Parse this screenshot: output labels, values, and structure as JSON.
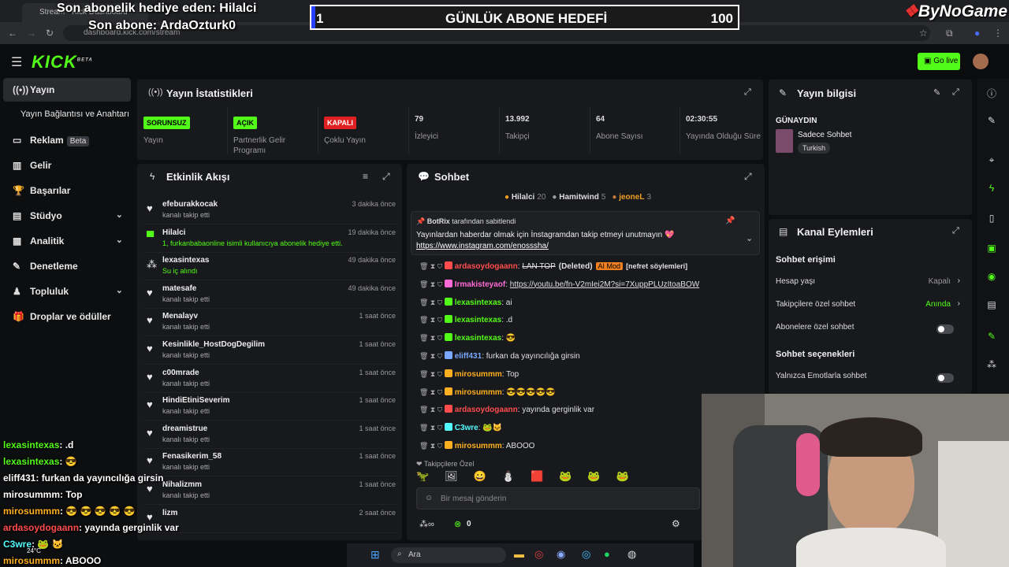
{
  "overlay": {
    "last_gift": "Son abonelik hediye eden: Hilalci",
    "last_sub": "Son abone: ArdaOzturk0",
    "goal": {
      "current": "1",
      "title": "GÜNLÜK ABONE HEDEFİ",
      "target": "100",
      "progress": 0.01
    },
    "brand": "ByNoGame"
  },
  "browser": {
    "tab_title": "Stream - Kick Dashboard",
    "url": "dashboard.kick.com/stream"
  },
  "header": {
    "logo": "KICK",
    "logo_beta": "BETA",
    "go_live": "Go live"
  },
  "sidebar": {
    "items": [
      {
        "label": "Yayın",
        "icon": "broadcast-icon"
      },
      {
        "label": "Yayın Bağlantısı ve Anahtarı"
      },
      {
        "label": "Reklam",
        "badge": "Beta",
        "icon": "ad-icon"
      },
      {
        "label": "Gelir",
        "icon": "chart-icon"
      },
      {
        "label": "Başarılar",
        "icon": "trophy-icon"
      },
      {
        "label": "Stüdyo",
        "icon": "studio-icon"
      },
      {
        "label": "Analitik",
        "icon": "analytics-icon"
      },
      {
        "label": "Denetleme",
        "icon": "wrench-icon"
      },
      {
        "label": "Topluluk",
        "icon": "community-icon"
      },
      {
        "label": "Droplar ve ödüller",
        "icon": "gift-icon"
      }
    ]
  },
  "stats": {
    "title": "Yayın İstatistikleri",
    "items": [
      {
        "value": "SORUNSUZ",
        "label": "Yayın",
        "color": "#53fc18"
      },
      {
        "value": "AÇIK",
        "label": "Partnerlik Gelir Programı",
        "color": "#53fc18"
      },
      {
        "value": "KAPALI",
        "label": "Çoklu Yayın",
        "color": "#e02020"
      },
      {
        "value": "79",
        "label": "İzleyici"
      },
      {
        "value": "13.992",
        "label": "Takipçi"
      },
      {
        "value": "64",
        "label": "Abone Sayısı"
      },
      {
        "value": "02:30:55",
        "label": "Yayında Olduğu Süre"
      }
    ]
  },
  "activity": {
    "title": "Etkinlik Akışı",
    "items": [
      {
        "name": "efeburakkocak",
        "sub": "kanalı takip etti",
        "time": "3 dakika önce"
      },
      {
        "name": "Hilalci",
        "sub": "1, furkanbabaonline isimli kullanıcıya abonelik hediye etti.",
        "time": "19 dakika önce"
      },
      {
        "name": "lexasintexas",
        "sub": "Su iç alındı",
        "time": "49 dakika önce"
      },
      {
        "name": "matesafe",
        "sub": "kanalı takip etti",
        "time": "49 dakika önce"
      },
      {
        "name": "Menalayv",
        "sub": "kanalı takip etti",
        "time": "1 saat önce"
      },
      {
        "name": "Kesinlikle_HostDogDegilim",
        "sub": "kanalı takip etti",
        "time": "1 saat önce"
      },
      {
        "name": "c00mrade",
        "sub": "kanalı takip etti",
        "time": "1 saat önce"
      },
      {
        "name": "HindiEtiniSeverim",
        "sub": "kanalı takip etti",
        "time": "1 saat önce"
      },
      {
        "name": "dreamistrue",
        "sub": "kanalı takip etti",
        "time": "1 saat önce"
      },
      {
        "name": "Fenasikerim_58",
        "sub": "kanalı takip etti",
        "time": "1 saat önce"
      },
      {
        "name": "Nihalizmm",
        "sub": "kanalı takip etti",
        "time": "1 saat önce"
      },
      {
        "name": "lizm",
        "sub": "",
        "time": "2 saat önce"
      }
    ]
  },
  "chat": {
    "title": "Sohbet",
    "top_gifters": [
      {
        "name": "Hilalci",
        "count": "20"
      },
      {
        "name": "Hamitwind",
        "count": "5"
      },
      {
        "name": "jeoneL",
        "count": "3"
      }
    ],
    "pinned": {
      "by": "BotRix",
      "by_suffix": "tarafından sabitlendi",
      "text": "Yayınlardan haberdar olmak için İnstagramdan takip etmeyi unutmayın 💖",
      "link": "https://www.instagram.com/enossshа/"
    },
    "messages": [
      {
        "user": "ardasoydogaann",
        "color": "#ff4d4d",
        "text": "LAN TOP",
        "extra": "(Deleted)",
        "tag": "AI Mod",
        "tag2": "[nefret söylemleri]"
      },
      {
        "user": "Irmakisteyaof",
        "color": "#ff6bd6",
        "text": "https://youtu.be/fn-V2mIei2M?si=7XuppPLUzItoaBOW"
      },
      {
        "user": "lexasintexas",
        "color": "#53fc18",
        "text": "ai"
      },
      {
        "user": "lexasintexas",
        "color": "#53fc18",
        "text": ".d"
      },
      {
        "user": "lexasintexas",
        "color": "#53fc18",
        "text": "😎"
      },
      {
        "user": "eliff431",
        "color": "#7aa7ff",
        "text": "furkan da yayıncılığa girsin"
      },
      {
        "user": "mirosummm",
        "color": "#ffb020",
        "text": "Top"
      },
      {
        "user": "mirosummm",
        "color": "#ffb020",
        "text": "😎😎😎😎😎"
      },
      {
        "user": "ardasoydogaann",
        "color": "#ff4d4d",
        "text": "yayında gerginlik var"
      },
      {
        "user": "C3wre",
        "color": "#53fcff",
        "text": "🐸🐱"
      },
      {
        "user": "mirosummm",
        "color": "#ffb020",
        "text": "ABOOO"
      }
    ],
    "follower_only_label": "Takipçilere Özel",
    "input_placeholder": "Bir mesaj gönderin",
    "footer_count": "0"
  },
  "stream_info": {
    "title": "Yayın bilgisi",
    "stream_title": "GÜNAYDIN",
    "category": "Sadece Sohbet",
    "language": "Turkish"
  },
  "channel_actions": {
    "title": "Kanal Eylemleri",
    "chat_access": "Sohbet erişimi",
    "account_age": "Hesap yaşı",
    "account_age_value": "Kapalı",
    "followers_only": "Takipçilere özel sohbet",
    "followers_only_value": "Anında",
    "subs_only": "Abonelere özel sohbet",
    "chat_options": "Sohbet seçenekleri",
    "emote_only": "Yalnızca Emotlarla sohbet"
  },
  "overlay_chat": [
    {
      "user": "lexasintexas",
      "text": ": .d",
      "color": "#53fc18"
    },
    {
      "user": "lexasintexas",
      "text": ": 😎",
      "color": "#53fc18"
    },
    {
      "user": "eliff431",
      "text": ": furkan da yayıncılığa girsin",
      "color": "#ffffff"
    },
    {
      "user": "mirosummm",
      "text": ": Top",
      "color": "#ffffff"
    },
    {
      "user": "mirosummm",
      "text": ": 😎 😎 😎 😎 😎",
      "color": "#ffb020"
    },
    {
      "user": "ardasoydogaann",
      "text": ": yayında gerginlik var",
      "color": "#ff4d4d"
    },
    {
      "user": "C3wre",
      "text": ": 🐸 🐱",
      "color": "#53fcff"
    },
    {
      "user": "mirosummm",
      "text": ": ABOOO",
      "color": "#ffb020"
    }
  ],
  "taskbar": {
    "search": "Ara",
    "temp": "24°C"
  }
}
